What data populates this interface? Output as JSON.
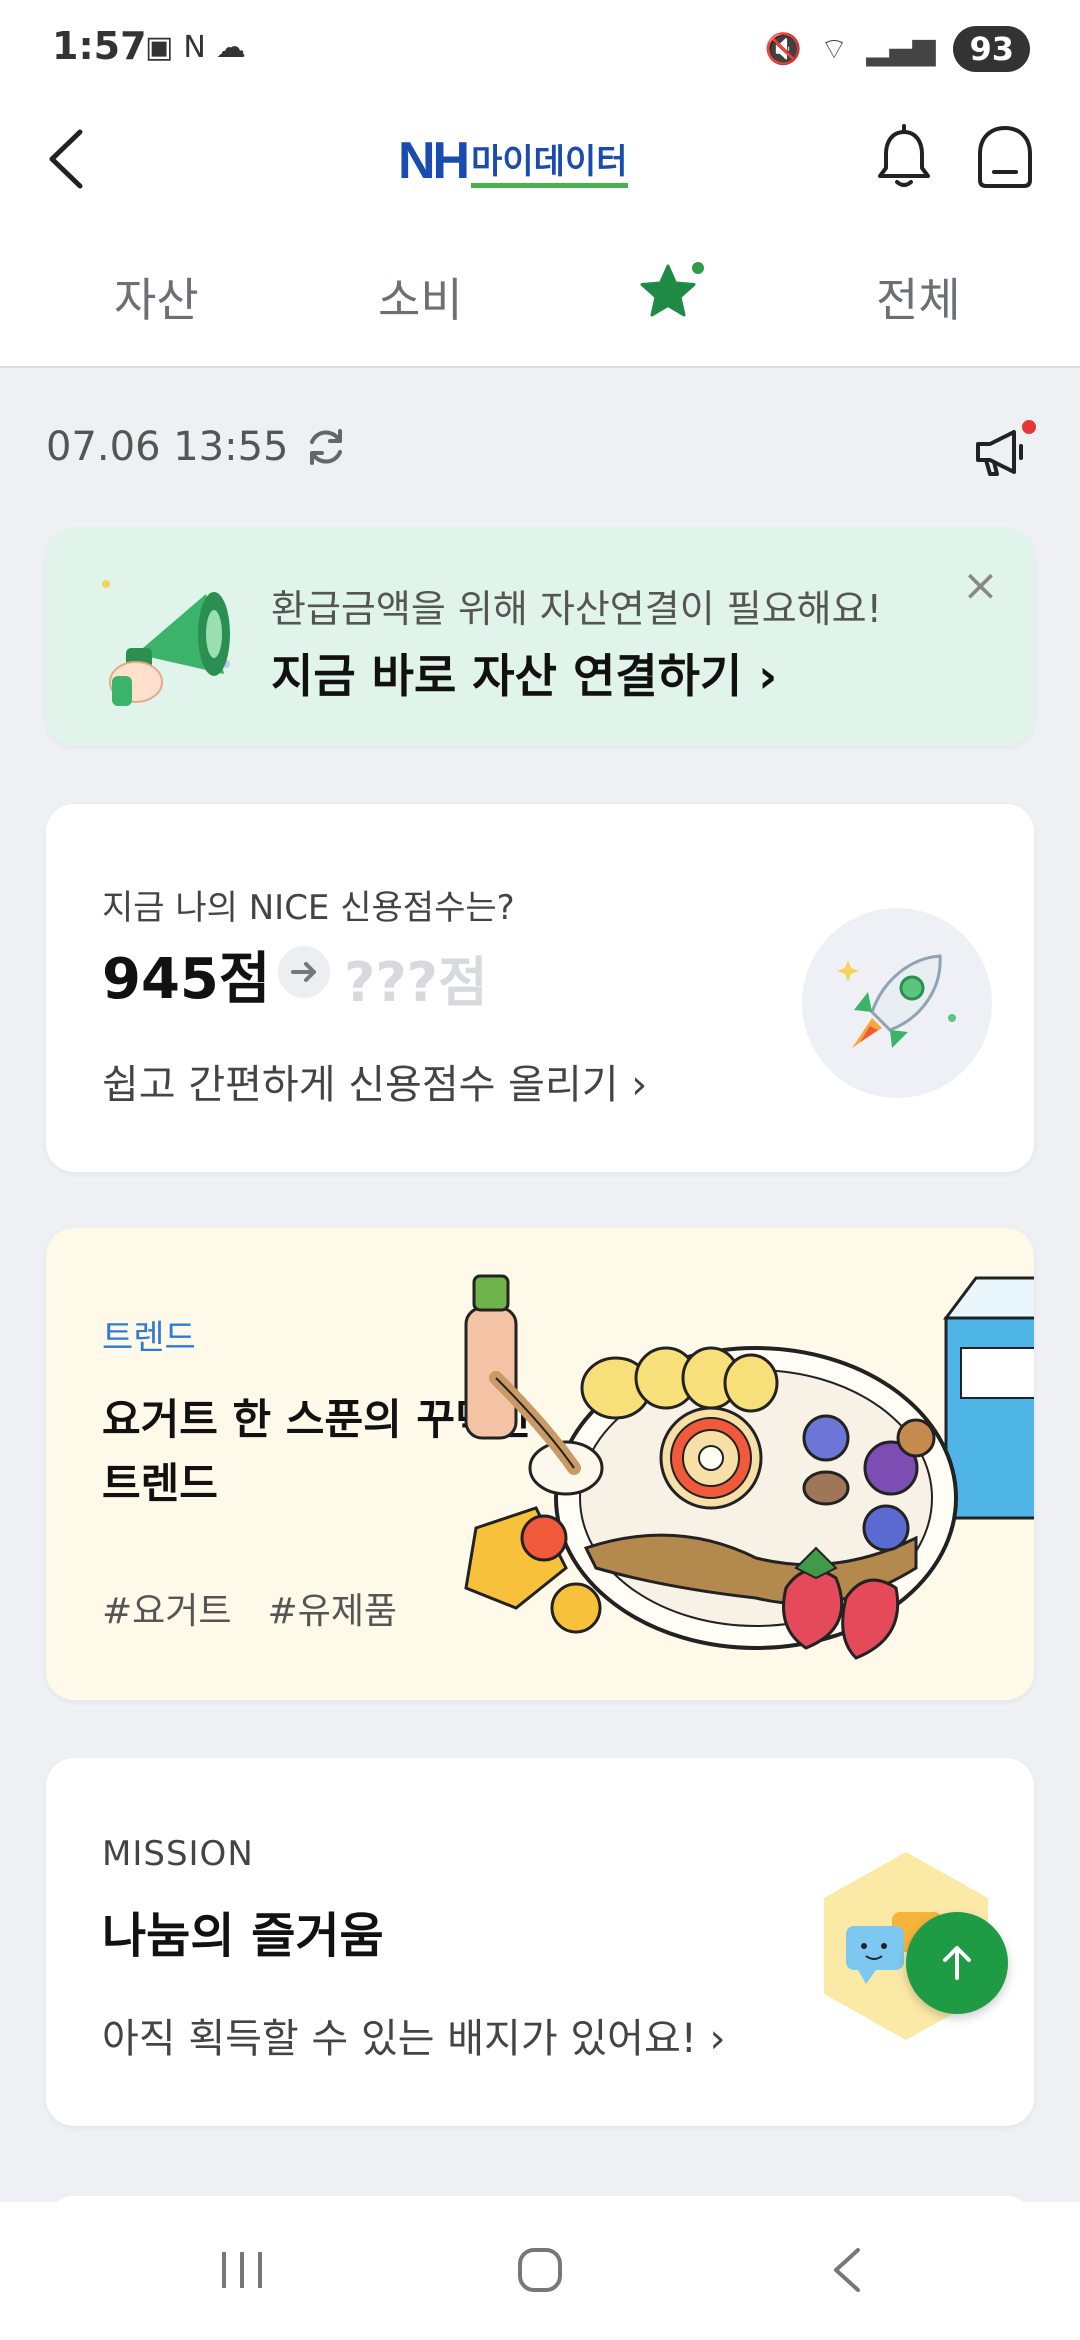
{
  "status_bar": {
    "time": "1:57",
    "battery": "93",
    "icons": [
      "screenshot-icon",
      "nfc-icon",
      "cloud-icon",
      "mute-icon",
      "wifi-icon",
      "signal-icon"
    ]
  },
  "header": {
    "logo_nh": "NH",
    "logo_text": "마이데이터",
    "icons": [
      "back-icon",
      "bell-icon",
      "inbox-icon"
    ]
  },
  "tabs": [
    {
      "label": "자산"
    },
    {
      "label": "소비"
    },
    {
      "label": "",
      "icon": "star-icon",
      "active": true
    },
    {
      "label": "전체"
    }
  ],
  "updated": {
    "datetime": "07.06 13:55"
  },
  "banner": {
    "subtitle": "환급금액을 위해 자산연결이 필요해요!",
    "title": "지금 바로 자산 연결하기 ›",
    "close": "×"
  },
  "credit_card": {
    "question": "지금 나의 NICE 신용점수는?",
    "score": "945점",
    "target": "???점",
    "link": "쉽고 간편하게 신용점수 올리기 ›"
  },
  "trend_card": {
    "tag": "트렌드",
    "title": "요거트 한 스푼의 꾸덕한 트렌드",
    "hashtags": [
      "#요거트",
      "#유제품"
    ]
  },
  "mission_card": {
    "tag": "MISSION",
    "title": "나눔의 즐거움",
    "link": "아직 획득할 수 있는 배지가 있어요! ›"
  },
  "colors": {
    "brand_green": "#1f9a45",
    "brand_blue": "#1a4bb0",
    "banner_bg": "#e0f4ec",
    "trend_bg": "#fff9ea",
    "tag_blue": "#2d7bd9",
    "alert_red": "#e53935"
  }
}
